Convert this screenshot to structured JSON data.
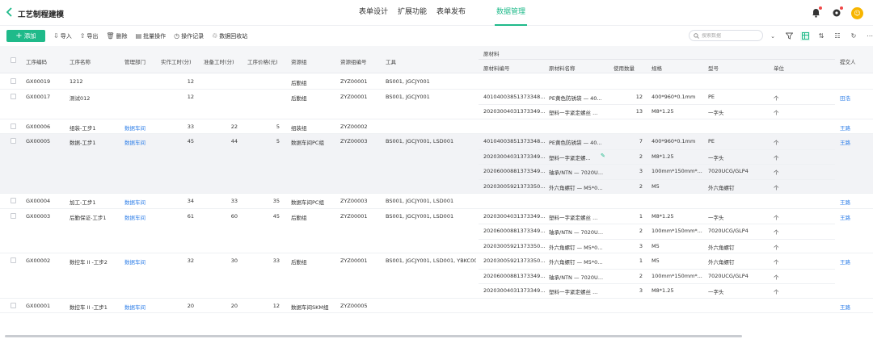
{
  "app": {
    "title": "工艺制程建模"
  },
  "nav": [
    "表单设计",
    "扩展功能",
    "表单发布",
    "数据管理"
  ],
  "toolbar": {
    "add": "添加",
    "tools": [
      {
        "label": "导入",
        "icon": "import-icon",
        "glyph": "⇩"
      },
      {
        "label": "导出",
        "icon": "export-icon",
        "glyph": "⇧"
      },
      {
        "label": "删除",
        "icon": "trash-icon",
        "glyph": "🗑"
      },
      {
        "label": "批量操作",
        "icon": "batch-icon",
        "glyph": "▤"
      },
      {
        "label": "操作记录",
        "icon": "history-icon",
        "glyph": "◷"
      },
      {
        "label": "数据回收站",
        "icon": "recycle-icon",
        "glyph": "♲"
      }
    ],
    "search_placeholder": "搜索数据"
  },
  "accent": "#1fba8a",
  "link_color": "#2f7fe8",
  "table": {
    "headers": {
      "code": "工序编码",
      "name": "工序名称",
      "dept": "管理部门",
      "actual": "实作工时(分)",
      "prep": "准备工时(分)",
      "price": "工序价格(元)",
      "group": "资源组",
      "group_no": "资源组编号",
      "tools": "工具",
      "material": "原材料",
      "mat_no": "原材料编号",
      "mat_name": "原材料名称",
      "qty": "使用数量",
      "spec": "规格",
      "model": "型号",
      "unit": "单位",
      "submitter": "提交人"
    },
    "rows": [
      {
        "code": "GX00019",
        "name": "1212",
        "dept": "",
        "actual": "12",
        "prep": "",
        "price": "",
        "group": "后勤组",
        "group_no": "ZYZ00001",
        "tools": "BS001, JGCJY001",
        "submitter": "",
        "mats": []
      },
      {
        "code": "GX00017",
        "name": "测试012",
        "dept": "",
        "actual": "12",
        "prep": "",
        "price": "",
        "group": "后勤组",
        "group_no": "ZYZ00001",
        "tools": "BS001, JGCJY001",
        "submitter": "田浩",
        "mats": [
          {
            "no": "40104003851373348...",
            "name": "PE黄色防锈袋 — 40...",
            "qty": "12",
            "spec": "400*960*0.1mm",
            "model": "PE",
            "unit": "个"
          },
          {
            "no": "20203004031373349...",
            "name": "塑料一字紧定螺丝 ...",
            "qty": "13",
            "spec": "M8*1.25",
            "model": "一字头",
            "unit": "个"
          }
        ]
      },
      {
        "code": "GX00006",
        "name": "组装-工步1",
        "dept": "数据车间",
        "actual": "33",
        "prep": "22",
        "price": "5",
        "group": "组装组",
        "group_no": "ZYZ00002",
        "tools": "",
        "submitter": "王路",
        "mats": []
      },
      {
        "code": "GX00005",
        "name": "数据-工步1",
        "dept": "数据车间",
        "actual": "45",
        "prep": "44",
        "price": "5",
        "group": "数据车间PC组",
        "group_no": "ZYZ00003",
        "tools": "BS001, JGCJY001, LSD001",
        "submitter": "王路",
        "mats": [
          {
            "no": "40104003851373348...",
            "name": "PE黄色防锈袋 — 40...",
            "qty": "7",
            "spec": "400*960*0.1mm",
            "model": "PE",
            "unit": "个"
          },
          {
            "no": "20203004031373349...",
            "name": "塑料一字紧定螺...",
            "qty": "2",
            "spec": "M8*1.25",
            "model": "一字头",
            "unit": "个"
          },
          {
            "no": "20206000881373349...",
            "name": "轴承/NTN — 7020U...",
            "qty": "3",
            "spec": "100mm*150mm*...",
            "model": "7020UCG/GLP4",
            "unit": "个"
          },
          {
            "no": "20203005921373350...",
            "name": "外六角螺钉 — M5*0...",
            "qty": "2",
            "spec": "M5",
            "model": "外六角螺钉",
            "unit": "个"
          }
        ]
      },
      {
        "code": "GX00004",
        "name": "加工-工步1",
        "dept": "数据车间",
        "actual": "34",
        "prep": "33",
        "price": "35",
        "group": "数据车间PC组",
        "group_no": "ZYZ00003",
        "tools": "BS001, JGCJY001, LSD001",
        "submitter": "王路",
        "mats": []
      },
      {
        "code": "GX00003",
        "name": "后勤保证-工步1",
        "dept": "数据车间",
        "actual": "61",
        "prep": "60",
        "price": "45",
        "group": "后勤组",
        "group_no": "ZYZ00001",
        "tools": "BS001, JGCJY001, LSD001",
        "submitter": "王路",
        "mats": [
          {
            "no": "20203004031373349...",
            "name": "塑料一字紧定螺丝 ...",
            "qty": "1",
            "spec": "M8*1.25",
            "model": "一字头",
            "unit": "个"
          },
          {
            "no": "20206000881373349...",
            "name": "轴承/NTN — 7020U...",
            "qty": "2",
            "spec": "100mm*150mm*...",
            "model": "7020UCG/GLP4",
            "unit": "个"
          },
          {
            "no": "20203005921373350...",
            "name": "外六角螺钉 — M5*0...",
            "qty": "3",
            "spec": "M5",
            "model": "外六角螺钉",
            "unit": "个"
          }
        ]
      },
      {
        "code": "GX00002",
        "name": "数控车 II -工步2",
        "dept": "数据车间",
        "actual": "32",
        "prep": "30",
        "price": "33",
        "group": "后勤组",
        "group_no": "ZYZ00001",
        "tools": "BS001, JGCJY001, LSD001, YBKC001",
        "submitter": "王路",
        "mats": [
          {
            "no": "20203005921373350...",
            "name": "外六角螺钉 — M5*0...",
            "qty": "1",
            "spec": "M5",
            "model": "外六角螺钉",
            "unit": "个"
          },
          {
            "no": "20206000881373349...",
            "name": "轴承/NTN — 7020U...",
            "qty": "2",
            "spec": "100mm*150mm*...",
            "model": "7020UCG/GLP4",
            "unit": "个"
          },
          {
            "no": "20203004031373349...",
            "name": "塑料一字紧定螺丝 ...",
            "qty": "3",
            "spec": "M8*1.25",
            "model": "一字头",
            "unit": "个"
          }
        ]
      },
      {
        "code": "GX00001",
        "name": "数控车 II -工步1",
        "dept": "数据车间",
        "actual": "20",
        "prep": "20",
        "price": "12",
        "group": "数据车间SKM组",
        "group_no": "ZYZ00005",
        "tools": "",
        "submitter": "王路",
        "mats": []
      }
    ]
  }
}
